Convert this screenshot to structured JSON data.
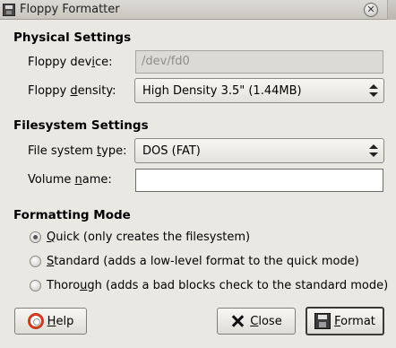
{
  "window": {
    "title": "Floppy Formatter",
    "close_glyph": "✕"
  },
  "physical": {
    "title": "Physical Settings",
    "device_label": "Floppy dev|i|ce:",
    "device_value": "/dev/fd0",
    "density_label": "Floppy |d|ensity:",
    "density_value": "High Density 3.5\" (1.44MB)"
  },
  "filesystem": {
    "title": "Filesystem Settings",
    "type_label": "File system |t|ype:",
    "type_value": "DOS (FAT)",
    "volume_label": "Volume |n|ame:",
    "volume_value": ""
  },
  "mode": {
    "title": "Formatting Mode",
    "options": [
      {
        "label": "|Q|uick (only creates the filesystem)",
        "checked": true
      },
      {
        "label": "|S|tandard (adds a low-level format to the quick mode)",
        "checked": false
      },
      {
        "label": "Thoro|u|gh (adds a bad blocks check to the standard mode)",
        "checked": false
      }
    ]
  },
  "buttons": {
    "help": "|H|elp",
    "close": "|C|lose",
    "format": "|F|ormat"
  }
}
